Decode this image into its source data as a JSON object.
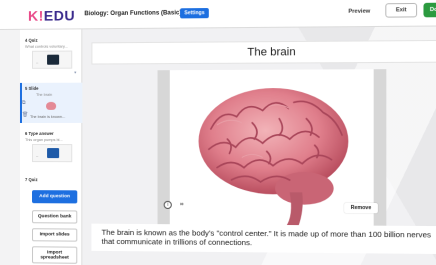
{
  "header": {
    "logo_k": "K!",
    "logo_rest": "EDU",
    "quiz_title": "Biology: Organ Functions (Basic)",
    "settings_label": "Settings",
    "preview_label": "Preview",
    "exit_label": "Exit",
    "done_label": "Done"
  },
  "sidebar": {
    "items": [
      {
        "number_type": "4  Quiz",
        "preview": "What controls voluntary..."
      },
      {
        "number_type": "5  Slide",
        "preview_title": "The brain",
        "caption": "The brain is known..."
      },
      {
        "number_type": "6  Type answer",
        "preview": "This organ pumps bl..."
      },
      {
        "number_type": "7  Quiz"
      }
    ],
    "add_question_label": "Add question",
    "question_bank_label": "Question bank",
    "import_slides_label": "Import slides",
    "import_spreadsheet_label": "Import spreadsheet"
  },
  "slide": {
    "title": "The brain",
    "remove_label": "Remove",
    "info_glyph": "i",
    "body_text": "The brain is known as the body's \"control center.\" It is made up of more than 100 billion nerves that communicate in trillions of connections."
  },
  "colors": {
    "accent": "#1d6fe0",
    "done": "#2b9a3f",
    "brand": "#3a2a8c"
  }
}
